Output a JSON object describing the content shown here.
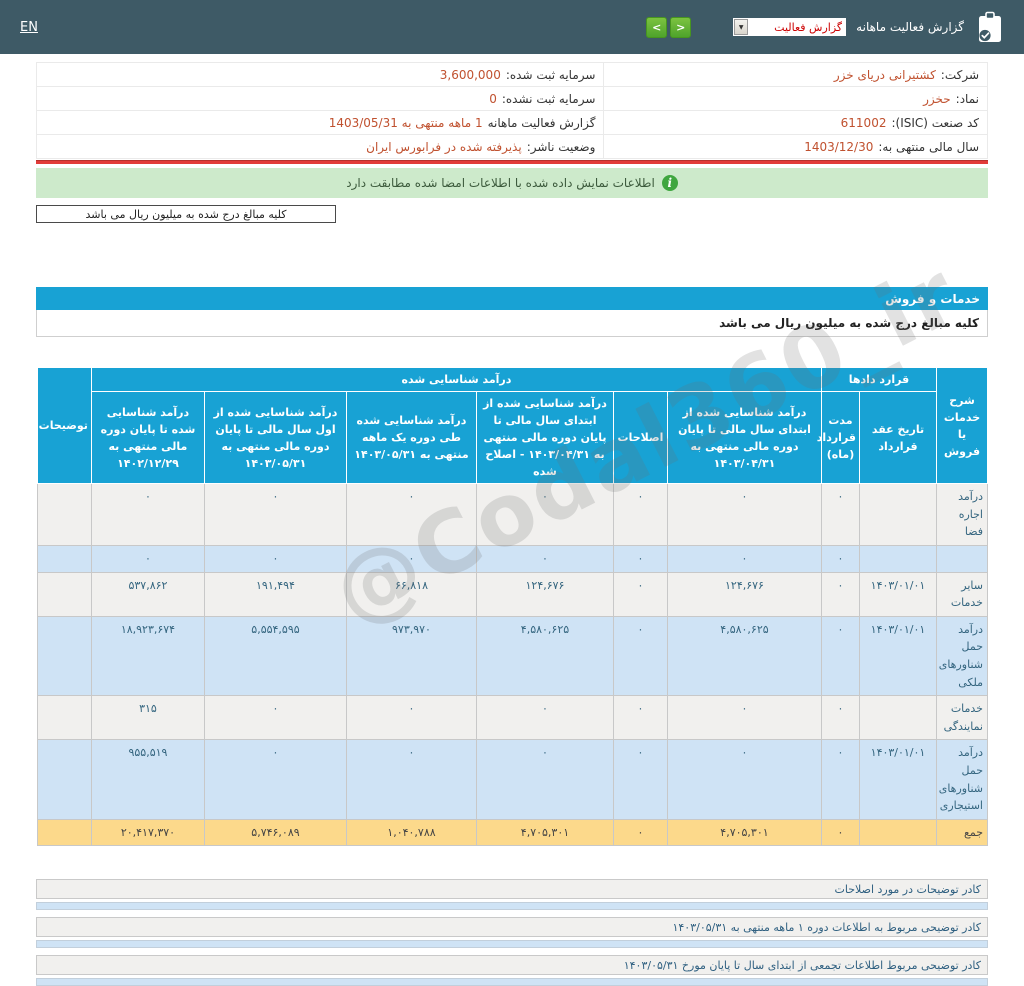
{
  "topbar": {
    "language_link": "EN",
    "prev_icon": "<",
    "next_icon": ">",
    "report_select_value": "گزارش فعالیت",
    "select_arrow": "▼",
    "report_type_label": "گزارش فعالیت ماهانه"
  },
  "info": {
    "rows": [
      {
        "right_label": "شرکت:",
        "right_value": "کشتیرانی دریای خزر",
        "left_label": "سرمایه ثبت شده:",
        "left_value": "3,600,000"
      },
      {
        "right_label": "نماد:",
        "right_value": "حخزر",
        "left_label": "سرمایه ثبت نشده:",
        "left_value": "0"
      },
      {
        "right_label": "کد صنعت (ISIC):",
        "right_value": "611002",
        "left_label": "گزارش فعالیت ماهانه",
        "left_value": "1 ماهه منتهی به 1403/05/31"
      },
      {
        "right_label": "سال مالی منتهی به:",
        "right_value": "1403/12/30",
        "left_label": "وضعیت ناشر:",
        "left_value": "پذیرفته شده در فرابورس ایران"
      }
    ]
  },
  "banner": {
    "info_icon": "i",
    "text": "اطلاعات نمایش داده شده با اطلاعات امضا شده مطابقت دارد"
  },
  "unit_note": "کلیه مبالغ درج شده به میلیون ریال می باشد",
  "section": {
    "title": "خدمات و فروش",
    "unit_note": "کلیه مبالغ درج شده به میلیون ریال می باشد"
  },
  "table": {
    "group_headers": {
      "desc": "شرح خدمات یا فروش",
      "contracts": "قرارد دادها",
      "revenue": "درآمد شناسایی شده",
      "notes": "توضیحات"
    },
    "sub_headers": [
      "تاریخ عقد قرارداد",
      "مدت قرارداد (ماه)",
      "درآمد شناسایی شده از ابتدای سال مالی تا پایان دوره مالی منتهی به ۱۴۰۳/۰۴/۳۱",
      "اصلاحات",
      "درآمد شناسایی شده از ابتدای سال مالی تا پایان دوره مالی منتهی به ۱۴۰۳/۰۴/۳۱ - اصلاح شده",
      "درآمد شناسایی شده طی دوره یک ماهه منتهی به ۱۴۰۳/۰۵/۳۱",
      "درآمد شناسایی شده از اول سال مالی تا پایان دوره مالی منتهی به ۱۴۰۳/۰۵/۳۱",
      "درآمد شناسایی شده تا پایان دوره مالی منتهی به ۱۴۰۲/۱۲/۲۹"
    ],
    "rows": [
      {
        "desc": "درآمد اجاره فضا",
        "variant": "grey",
        "cells": [
          "",
          "۰",
          "۰",
          "۰",
          "۰",
          "۰",
          "۰",
          "۰",
          ""
        ]
      },
      {
        "desc": "",
        "variant": "blue",
        "cells": [
          "",
          "۰",
          "۰",
          "۰",
          "۰",
          "۰",
          "۰",
          "۰",
          ""
        ]
      },
      {
        "desc": "سایر خدمات",
        "variant": "grey",
        "cells": [
          "۱۴۰۳/۰۱/۰۱",
          "۰",
          "۱۲۴,۶۷۶",
          "۰",
          "۱۲۴,۶۷۶",
          "۶۶,۸۱۸",
          "۱۹۱,۴۹۴",
          "۵۳۷,۸۶۲",
          ""
        ]
      },
      {
        "desc": "درآمد حمل شناورهای ملکی",
        "variant": "blue",
        "cells": [
          "۱۴۰۳/۰۱/۰۱",
          "۰",
          "۴,۵۸۰,۶۲۵",
          "۰",
          "۴,۵۸۰,۶۲۵",
          "۹۷۳,۹۷۰",
          "۵,۵۵۴,۵۹۵",
          "۱۸,۹۲۳,۶۷۴",
          ""
        ]
      },
      {
        "desc": "خدمات نمایندگی",
        "variant": "grey",
        "cells": [
          "",
          "۰",
          "۰",
          "۰",
          "۰",
          "۰",
          "۰",
          "۳۱۵",
          ""
        ]
      },
      {
        "desc": "درآمد حمل شناورهای استیجاری",
        "variant": "blue",
        "cells": [
          "۱۴۰۳/۰۱/۰۱",
          "۰",
          "۰",
          "۰",
          "۰",
          "۰",
          "۰",
          "۹۵۵,۵۱۹",
          ""
        ]
      },
      {
        "desc": "جمع",
        "variant": "total",
        "cells": [
          "",
          "۰",
          "۴,۷۰۵,۳۰۱",
          "۰",
          "۴,۷۰۵,۳۰۱",
          "۱,۰۴۰,۷۸۸",
          "۵,۷۴۶,۰۸۹",
          "۲۰,۴۱۷,۳۷۰",
          ""
        ]
      }
    ]
  },
  "notes": [
    "کادر توضیحات در مورد اصلاحات",
    "کادر توضیحی مربوط به اطلاعات دوره ۱ ماهه منتهی به ۱۴۰۳/۰۵/۳۱",
    "کادر توضیحی مربوط اطلاعات تجمعی از ابتدای سال تا پایان مورخ ۱۴۰۳/۰۵/۳۱"
  ],
  "watermark": "@Codal360_ir",
  "colors": {
    "topbar": "#3e5a66",
    "accent_blue": "#18a2d4",
    "nav_green": "#5cb531",
    "value_orange": "#c0512f",
    "banner_green": "#cdeacb",
    "row_blue": "#cfe3f5",
    "row_grey": "#f1f0ee",
    "total_yellow": "#fcd98b",
    "red_line": "#e23c39"
  }
}
